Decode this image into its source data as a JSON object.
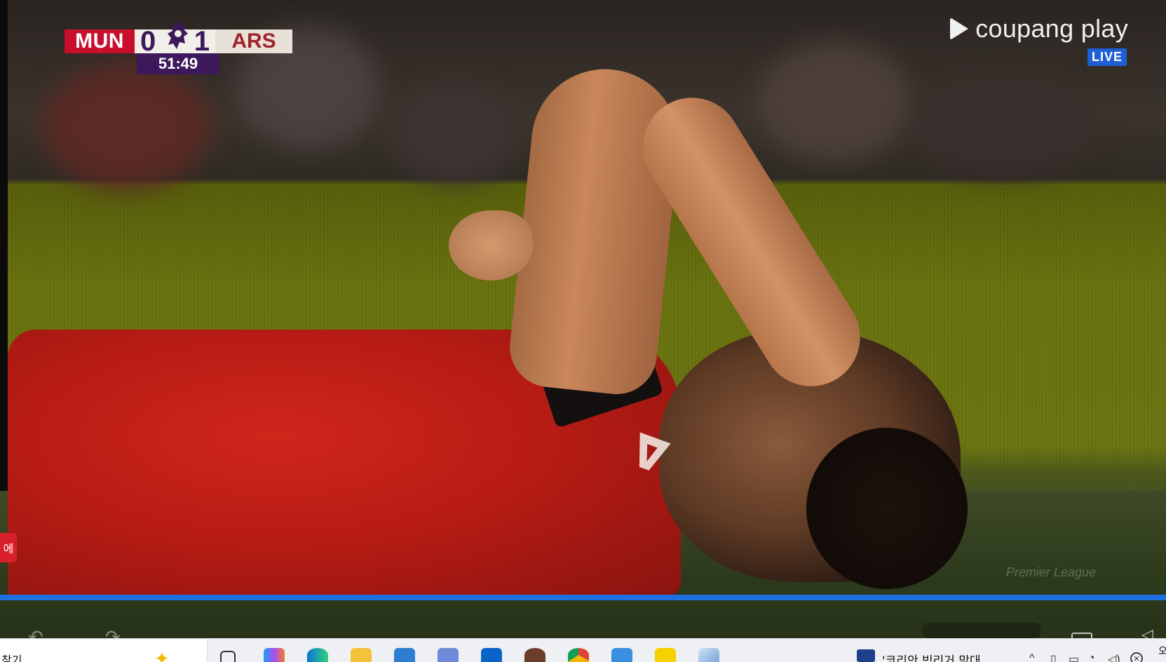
{
  "scoreboard": {
    "home_team": "MUN",
    "home_score": "0",
    "away_score": "1",
    "away_team": "ARS",
    "clock": "51:49"
  },
  "broadcaster": {
    "name": "coupang play",
    "badge": "LIVE",
    "watermark": "Premier League"
  },
  "side_tab": {
    "label": "에"
  },
  "playback": {
    "progress_fraction": 1.0
  },
  "taskbar": {
    "search_text": "찾기",
    "news_text": "'코리안 빅리거 맏대",
    "icons": [
      "search-sparkle-icon",
      "task-view-icon",
      "copilot-icon",
      "edge-icon",
      "file-explorer-icon",
      "store-icon",
      "settings-icon",
      "outlook-icon",
      "app-icon",
      "chrome-icon",
      "app-tile-icon",
      "kakaotalk-icon",
      "pen-icon"
    ],
    "clock_fragment": "오"
  },
  "colors": {
    "home": "#c8102e",
    "league_purple": "#3d195b",
    "progress": "#1e6fe0",
    "live": "#1f5fd6"
  }
}
